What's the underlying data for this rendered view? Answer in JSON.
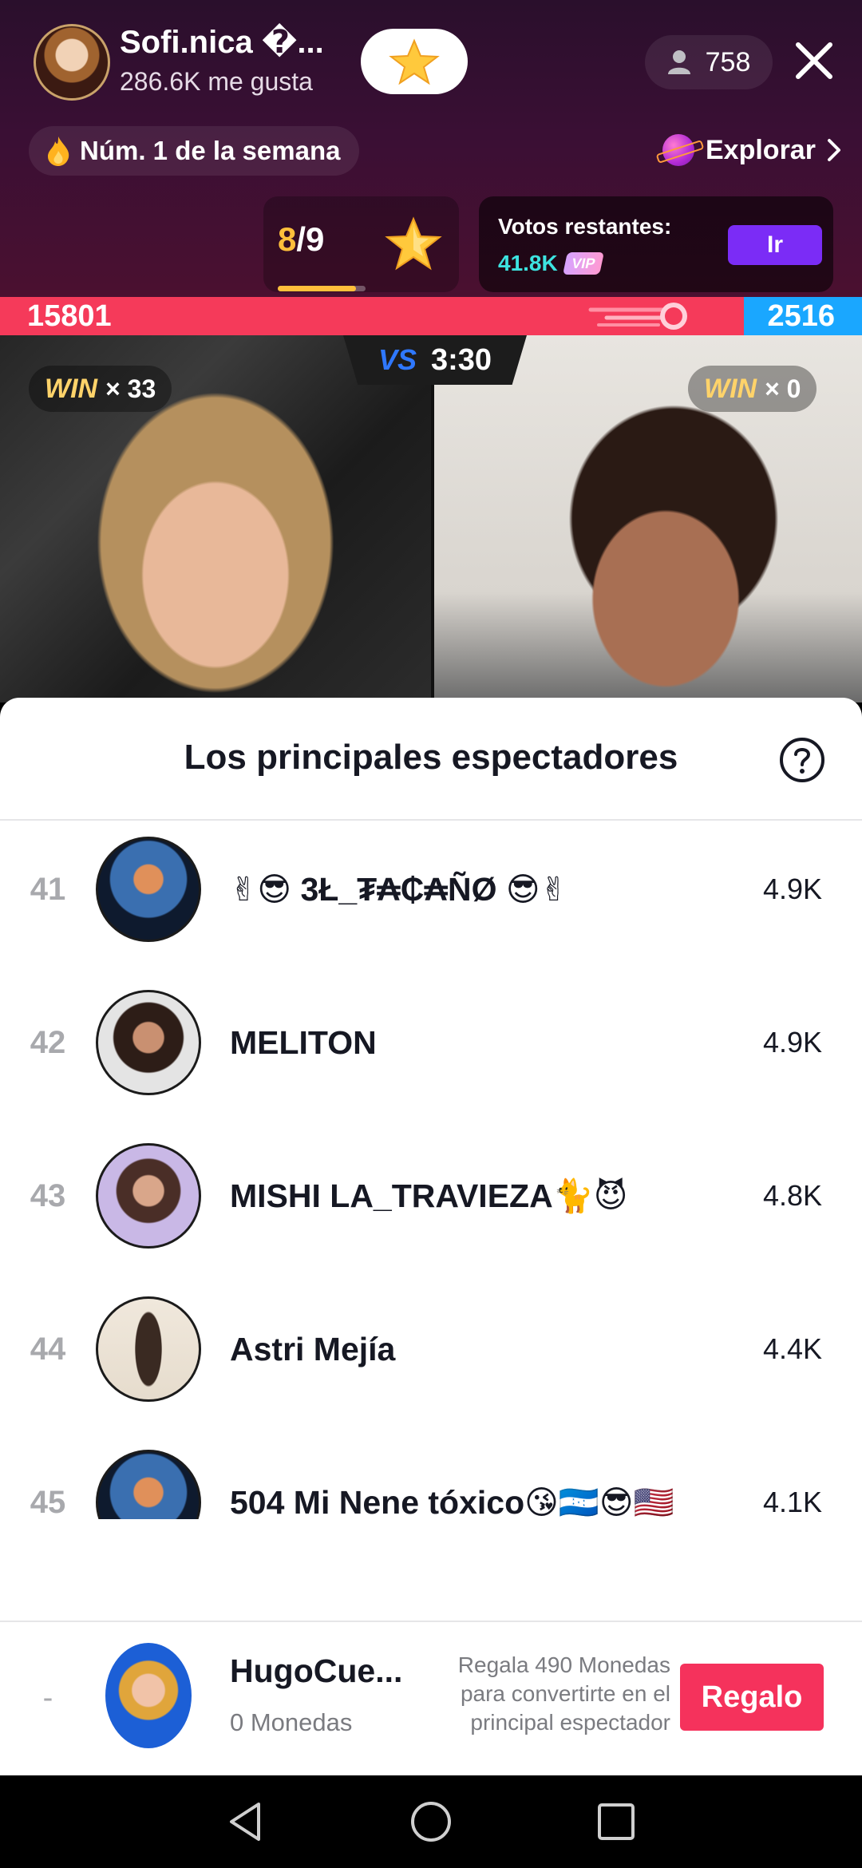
{
  "header": {
    "host_name": "Sofi.nica �...",
    "likes": "286.6K me gusta",
    "viewer_count": "758",
    "rank_badge": "Núm. 1 de la semana",
    "explore_label": "Explorar",
    "battle_current": "8",
    "battle_total": "/9",
    "battle_progress": 0.89,
    "votes_title": "Votos restantes:",
    "votes_value": "41.8K",
    "vip_label": "VIP",
    "go_label": "Ir"
  },
  "battle": {
    "left_score": "15801",
    "right_score": "2516",
    "left_share": 0.8627,
    "vs_label": "VS",
    "timer": "3:30",
    "win_word": "WIN",
    "left_wins": "× 33",
    "right_wins": "× 0"
  },
  "sheet": {
    "title": "Los principales espectadores",
    "rows": [
      {
        "rank": "41",
        "name": "✌😎 3Ł_₮₳₵₳ÑØ 😎✌",
        "coins": "4.9K"
      },
      {
        "rank": "42",
        "name": "MELITON",
        "coins": "4.9K"
      },
      {
        "rank": "43",
        "name": "MISHI LA_TRAVIEZA🐈😈",
        "coins": "4.8K"
      },
      {
        "rank": "44",
        "name": "Astri Mejía",
        "coins": "4.4K"
      },
      {
        "rank": "45",
        "name": "504 Mi Nene tóxico😘🇭🇳😎🇺🇸",
        "coins": "4.1K"
      }
    ],
    "self": {
      "rank": "-",
      "name": "HugoCue...",
      "coins": "0 Monedas",
      "hint": "Regala 490 Monedas para convertirte en el principal espectador",
      "gift_label": "Regalo"
    }
  },
  "colors": {
    "red": "#f53a5a",
    "blue": "#1aa7ff",
    "gift": "#f5325c",
    "accent_purple": "#7b2cf6",
    "gold": "#ffbf3b"
  }
}
